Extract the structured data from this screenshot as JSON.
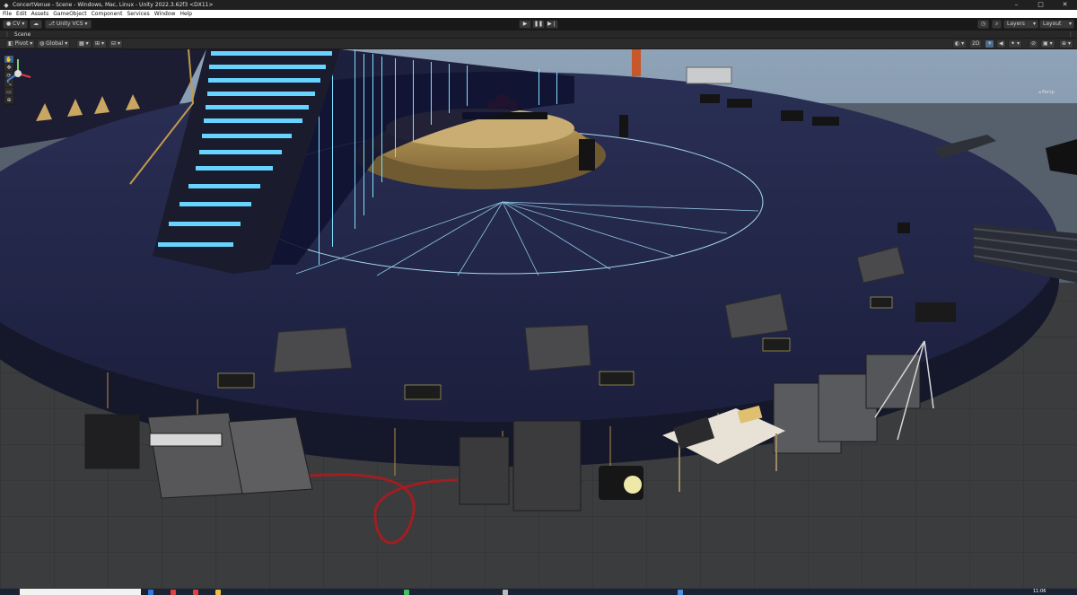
{
  "window": {
    "title": "ConcertVenue - Scene - Windows, Mac, Linux - Unity 2022.3.62f3 <DX11>",
    "controls": [
      "–",
      "□",
      "✕"
    ]
  },
  "menu": [
    "File",
    "Edit",
    "Assets",
    "GameObject",
    "Component",
    "Services",
    "Window",
    "Help"
  ],
  "toolbar": {
    "account": "CV",
    "vcs": "Unity VCS",
    "play": [
      "▶",
      "❚❚",
      "▶❘"
    ],
    "layers": "Layers",
    "layout": "Layout"
  },
  "tab": {
    "dots": "⋮",
    "label": "Scene",
    "menu": "⋮"
  },
  "scene_toolbar": {
    "pivot": "Pivot",
    "global": "Global",
    "mode_2d": "2D"
  },
  "tools": [
    "✋",
    "✥",
    "⟳",
    "⤡",
    "▭",
    "⊕"
  ],
  "gizmo": {
    "label": "◂ Persp"
  },
  "taskbar": {
    "clock": "11:06"
  },
  "colors": {
    "accent": "#3b5f86",
    "stage": "#1f2343",
    "led": "#7fe0ff",
    "floor": "#3a3a3a"
  }
}
